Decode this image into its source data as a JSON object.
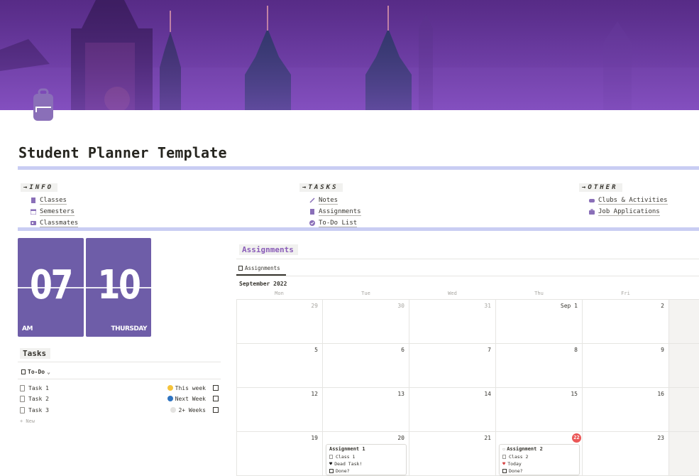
{
  "page": {
    "title": "Student Planner Template",
    "icon": "backpack-icon"
  },
  "nav": {
    "info": {
      "label": "→INFO",
      "items": [
        {
          "label": "Classes",
          "icon": "book-icon"
        },
        {
          "label": "Semesters",
          "icon": "calendar-icon"
        },
        {
          "label": "Classmates",
          "icon": "contact-card-icon"
        }
      ]
    },
    "tasks": {
      "label": "→TASKS",
      "items": [
        {
          "label": "Notes",
          "icon": "pencil-icon"
        },
        {
          "label": "Assignments",
          "icon": "document-icon"
        },
        {
          "label": "To-Do List",
          "icon": "check-circle-icon"
        }
      ]
    },
    "other": {
      "label": "→OTHER",
      "items": [
        {
          "label": "Clubs & Activities",
          "icon": "gamepad-icon"
        },
        {
          "label": "Job Applications",
          "icon": "briefcase-icon"
        }
      ]
    }
  },
  "clock": {
    "hour": "07",
    "minute": "10",
    "period": "AM",
    "day": "THURSDAY"
  },
  "tasks": {
    "heading": "Tasks",
    "view_label": "To-Do",
    "rows": [
      {
        "name": "Task 1",
        "due": "This week",
        "dot": "#f5c33b"
      },
      {
        "name": "Task 2",
        "due": "Next Week",
        "dot": "#2f74c0"
      },
      {
        "name": "Task 3",
        "due": "2+ Weeks",
        "dot": "#e3e2e0"
      }
    ],
    "new_label": "+ New"
  },
  "assignments": {
    "heading": "Assignments",
    "tab_label": "Assignments",
    "month_label": "September 2022",
    "weekdays": [
      "Mon",
      "Tue",
      "Wed",
      "Thu",
      "Fri"
    ],
    "weeks": [
      [
        "29",
        "30",
        "31",
        "Sep 1",
        "2"
      ],
      [
        "5",
        "6",
        "7",
        "8",
        "9"
      ],
      [
        "12",
        "13",
        "14",
        "15",
        "16"
      ],
      [
        "19",
        "20",
        "21",
        "22",
        "23"
      ]
    ],
    "today": "22",
    "cards": {
      "a1": {
        "title": "Assignment 1",
        "class": "Class 1",
        "status": "Dead Task!",
        "done": "Done?"
      },
      "a2": {
        "title": "Assignment 2",
        "class": "Class 2",
        "status": "Today",
        "done": "Done?"
      }
    }
  },
  "colors": {
    "accent_purple": "#6e5da8",
    "divider": "#c9cdf3",
    "today_badge": "#eb5757"
  }
}
